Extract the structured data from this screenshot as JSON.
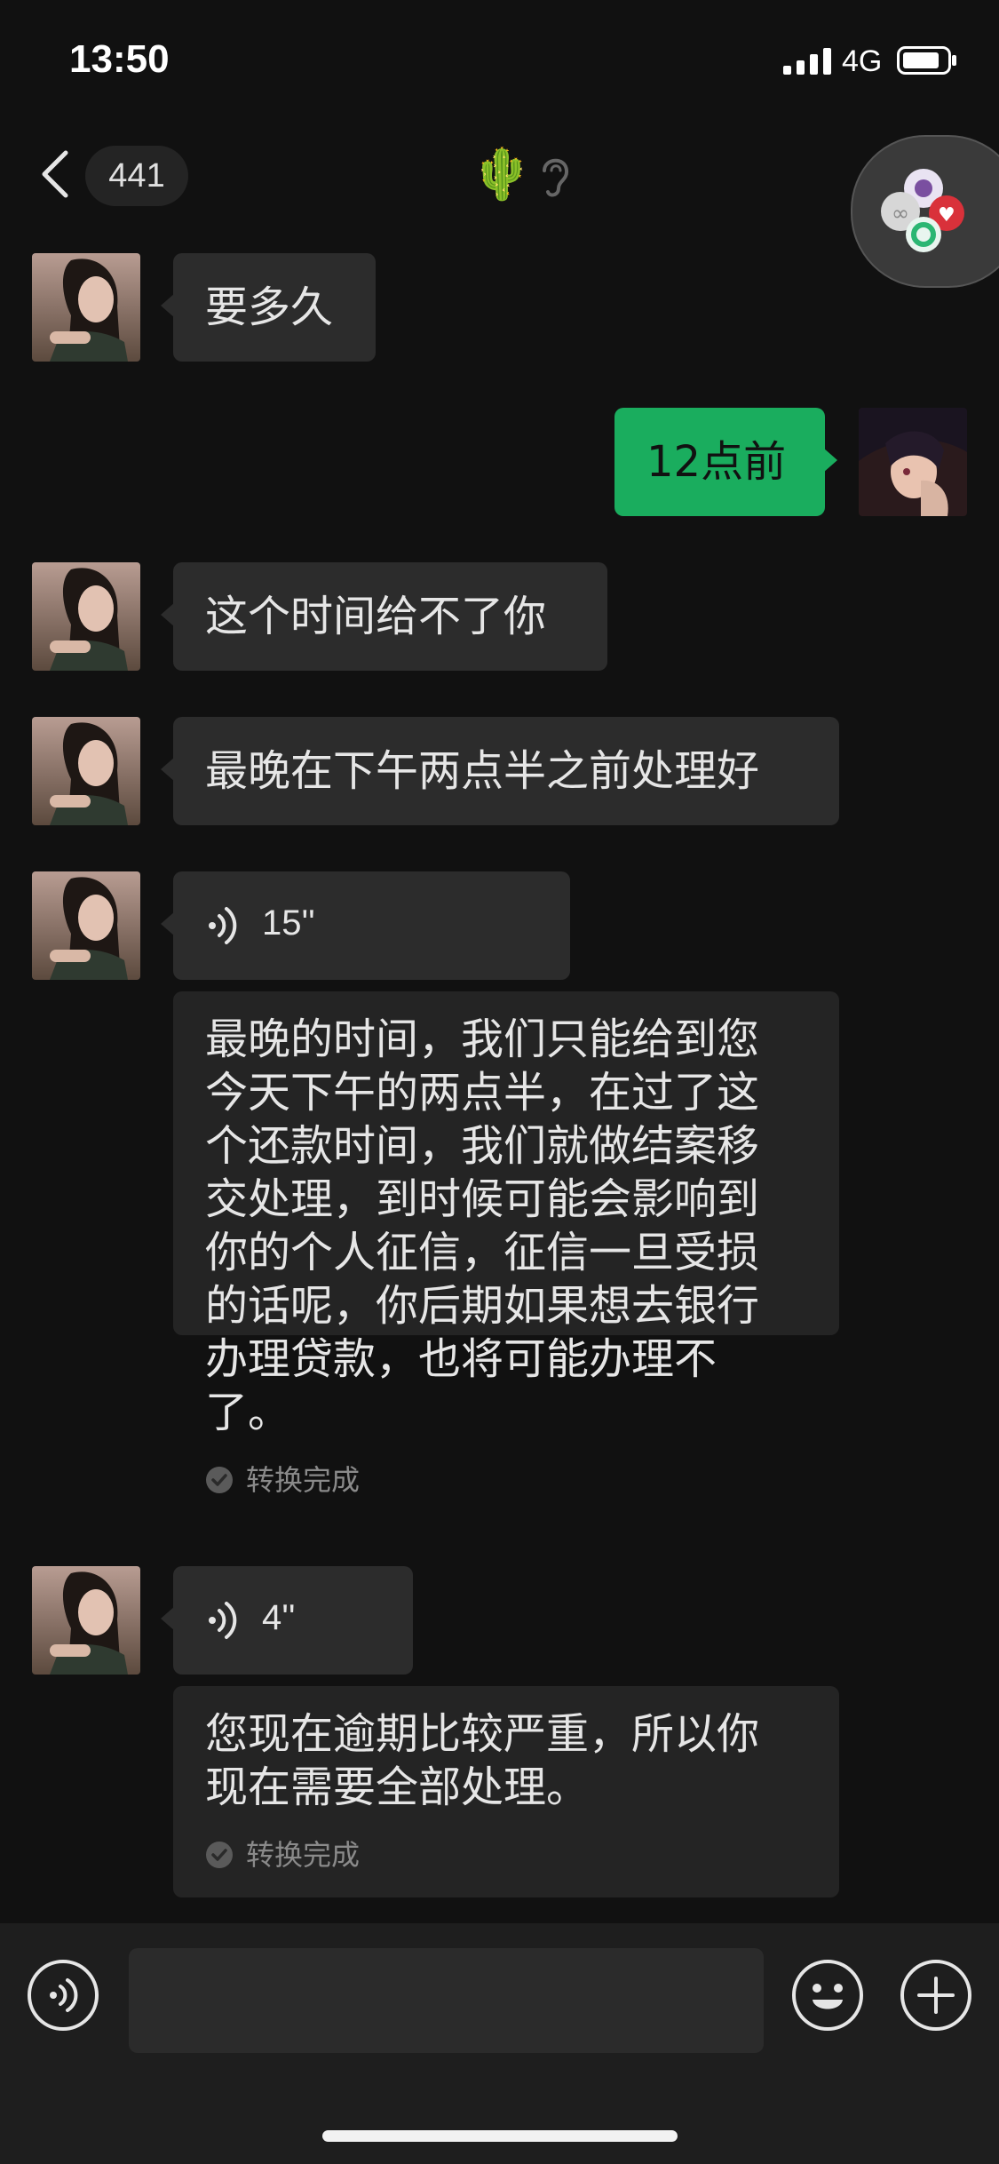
{
  "status_bar": {
    "time": "13:50",
    "network": "4G"
  },
  "header": {
    "unread_count": "441",
    "title_emoji": "🌵"
  },
  "messages": [
    {
      "side": "left",
      "type": "text",
      "text": "要多久"
    },
    {
      "side": "right",
      "type": "text",
      "text": "12点前"
    },
    {
      "side": "left",
      "type": "text",
      "text": "这个时间给不了你"
    },
    {
      "side": "left",
      "type": "text",
      "text": "最晚在下午两点半之前处理好"
    },
    {
      "side": "left",
      "type": "voice",
      "duration": "15''",
      "transcript_lines": [
        "最晚的时间，我们只能给到您",
        "今天下午的两点半，在过了这",
        "个还款时间，我们就做结案移",
        "交处理，到时候可能会影响到",
        "你的个人征信，征信一旦受损",
        "的话呢，你后期如果想去银行",
        "办理贷款，也将可能办理不",
        "了。"
      ],
      "status": "转换完成"
    },
    {
      "side": "left",
      "type": "voice",
      "duration": "4''",
      "transcript_lines": [
        "您现在逾期比较严重，所以你",
        "现在需要全部处理。"
      ],
      "status": "转换完成"
    }
  ],
  "colors": {
    "sent_bubble": "#1aad5e",
    "received_bubble": "#2c2c2c",
    "background": "#111111"
  }
}
